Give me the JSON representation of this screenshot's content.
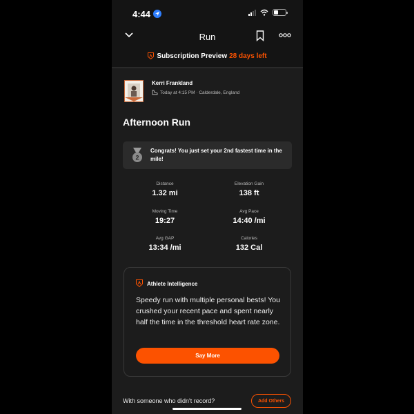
{
  "status_bar": {
    "time": "4:44"
  },
  "nav": {
    "title": "Run"
  },
  "subscription": {
    "label": "Subscription Preview",
    "days_left": "28 days left",
    "accent_color": "#fc5200"
  },
  "athlete": {
    "name": "Kerri Frankland",
    "meta": "Today at 4:15 PM · Calderdale, England"
  },
  "activity": {
    "title": "Afternoon Run"
  },
  "achievement": {
    "text": "Congrats! You just set your 2nd fastest time in the mile!",
    "rank": "2"
  },
  "stats": [
    {
      "label": "Distance",
      "value": "1.32 mi"
    },
    {
      "label": "Elevation Gain",
      "value": "138 ft"
    },
    {
      "label": "Moving Time",
      "value": "19:27"
    },
    {
      "label": "Avg Pace",
      "value": "14:40 /mi"
    },
    {
      "label": "Avg GAP",
      "value": "13:34 /mi"
    },
    {
      "label": "Calories",
      "value": "132 Cal"
    }
  ],
  "ai": {
    "title": "Athlete Intelligence",
    "body": "Speedy run with multiple personal bests! You crushed your recent pace and spent nearly half the time in the threshold heart rate zone.",
    "button": "Say More"
  },
  "footer": {
    "prompt": "With someone who didn't record?",
    "button": "Add Others"
  }
}
